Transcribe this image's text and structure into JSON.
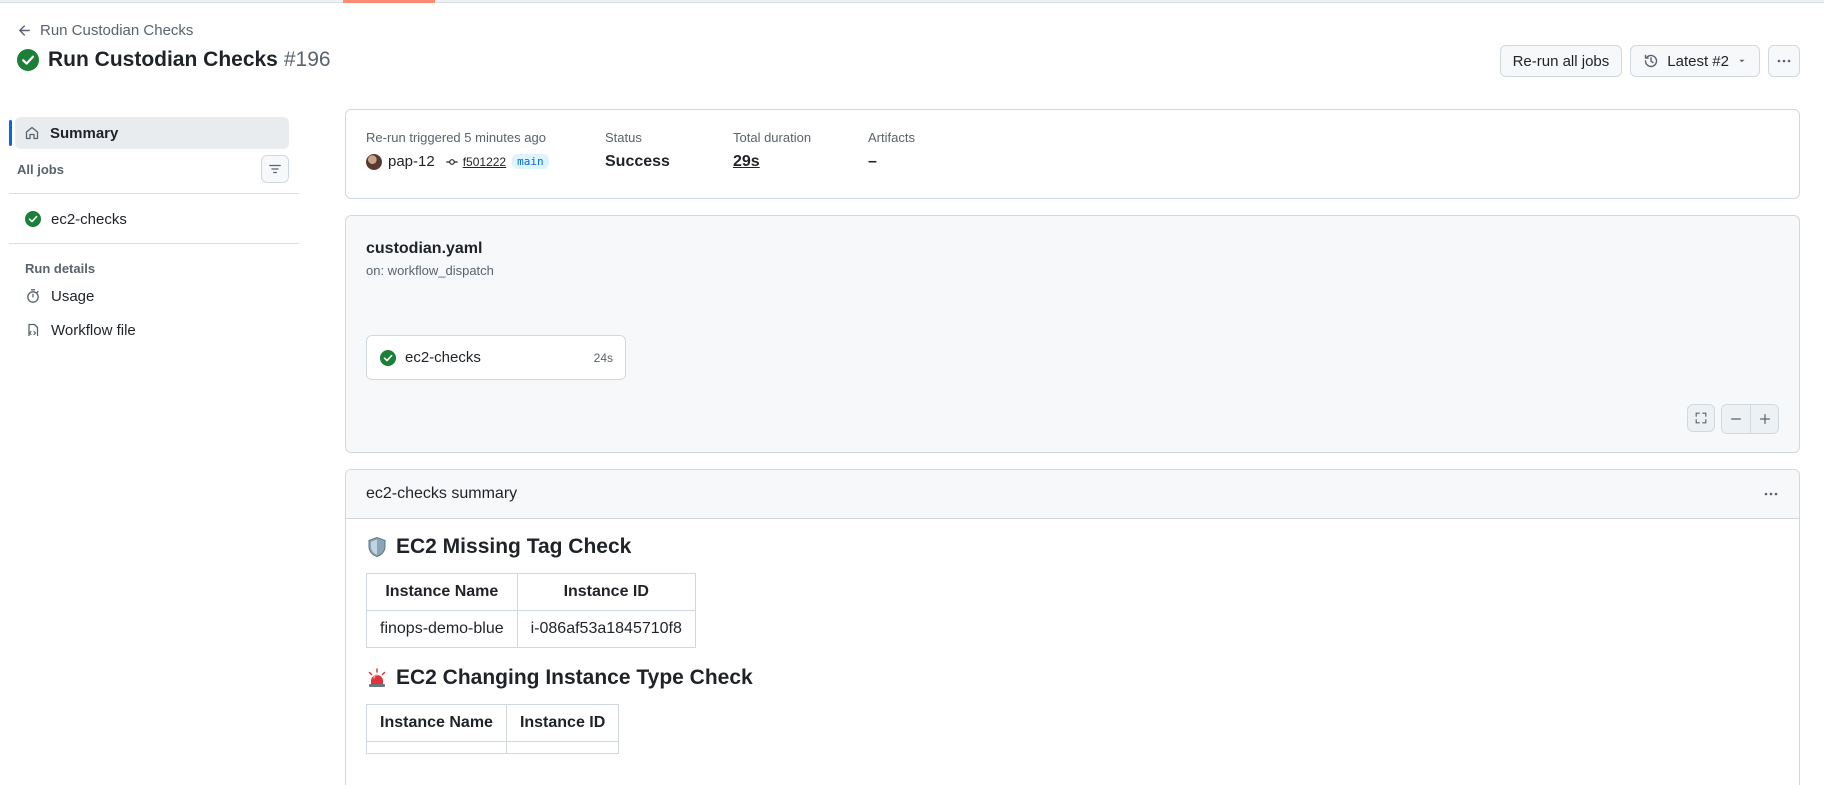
{
  "breadcrumb": {
    "back_label": "Run Custodian Checks"
  },
  "header": {
    "title": "Run Custodian Checks",
    "run_number": "#196",
    "actions": {
      "rerun_label": "Re-run all jobs",
      "attempt_label": "Latest #2"
    }
  },
  "sidebar": {
    "summary_label": "Summary",
    "all_jobs_label": "All jobs",
    "jobs": [
      {
        "label": "ec2-checks",
        "status": "success"
      }
    ],
    "run_details_label": "Run details",
    "links": [
      {
        "label": "Usage",
        "icon": "stopwatch-icon"
      },
      {
        "label": "Workflow file",
        "icon": "file-code-icon"
      }
    ]
  },
  "info": {
    "trigger_label": "Re-run triggered 5 minutes ago",
    "actor": "pap-12",
    "commit": "f501222",
    "branch": "main",
    "status_label": "Status",
    "status_value": "Success",
    "duration_label": "Total duration",
    "duration_value": "29s",
    "artifacts_label": "Artifacts",
    "artifacts_value": "–"
  },
  "graph": {
    "workflow_file": "custodian.yaml",
    "trigger": "on: workflow_dispatch",
    "job": {
      "name": "ec2-checks",
      "duration": "24s"
    }
  },
  "job_summary": {
    "title": "ec2-checks summary",
    "sections": [
      {
        "heading": "EC2 Missing Tag Check",
        "emoji": "shield-icon",
        "columns": [
          "Instance Name",
          "Instance ID"
        ],
        "rows": [
          [
            "finops-demo-blue",
            "i-086af53a1845710f8"
          ]
        ]
      },
      {
        "heading": "EC2 Changing Instance Type Check",
        "emoji": "rotating-light-icon",
        "columns": [
          "Instance Name",
          "Instance ID"
        ],
        "rows": [
          [
            "",
            ""
          ]
        ]
      }
    ]
  },
  "colors": {
    "success": "#1a7f37",
    "accent": "#0969da",
    "tab_underline": "#fd8c73"
  }
}
